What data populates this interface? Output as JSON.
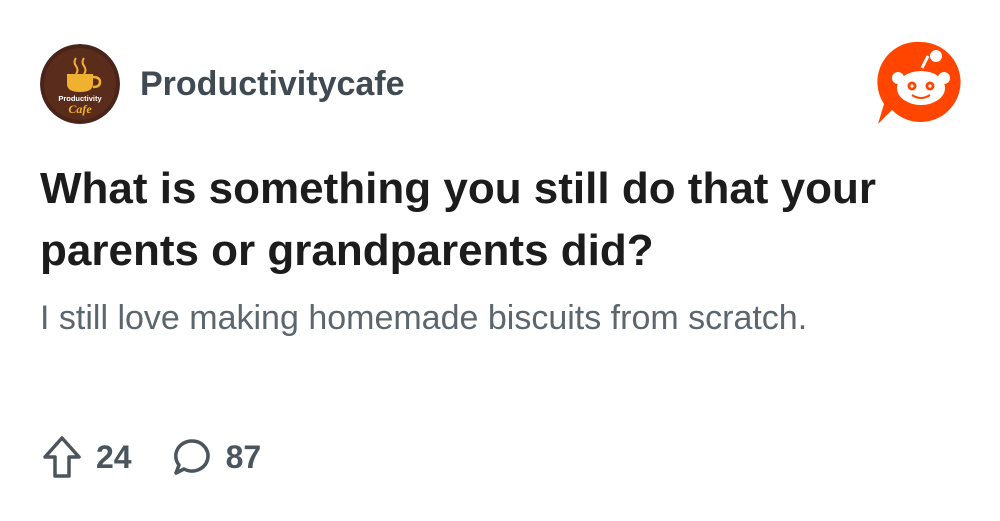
{
  "post": {
    "author": {
      "username": "Productivitycafe",
      "avatar_text_top": "Productivity",
      "avatar_text_bottom": "Cafe",
      "avatar_bg_color": "#4a2418",
      "avatar_accent_color": "#f0b030"
    },
    "title": "What is something you still do that your parents or grandparents did?",
    "body": "I still love making homemade biscuits from scratch.",
    "stats": {
      "upvotes": "24",
      "comments": "87"
    }
  },
  "brand": {
    "logo_icon": "reddit-snoo-icon",
    "logo_color": "#ff4500"
  },
  "icons": {
    "upvote": "arrow-up-icon",
    "comment": "speech-bubble-icon"
  }
}
